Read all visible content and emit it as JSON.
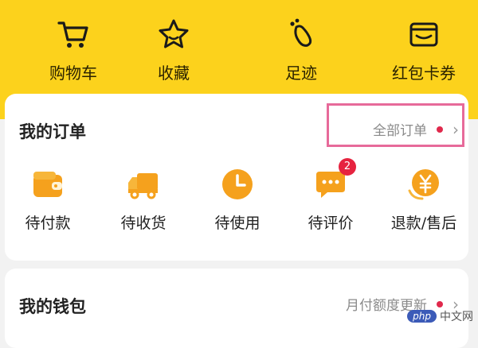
{
  "shortcuts": [
    {
      "label": "购物车",
      "icon": "shopping-cart-icon"
    },
    {
      "label": "收藏",
      "icon": "star-icon"
    },
    {
      "label": "足迹",
      "icon": "footprint-icon"
    },
    {
      "label": "红包卡券",
      "icon": "wallet-icon"
    }
  ],
  "orders": {
    "title": "我的订单",
    "all_orders_label": "全部订单",
    "items": [
      {
        "label": "待付款",
        "icon": "wallet-icon"
      },
      {
        "label": "待收货",
        "icon": "truck-icon"
      },
      {
        "label": "待使用",
        "icon": "clock-icon"
      },
      {
        "label": "待评价",
        "icon": "comment-icon",
        "badge": "2"
      },
      {
        "label": "退款/售后",
        "icon": "refund-icon"
      }
    ]
  },
  "wallet": {
    "title": "我的钱包",
    "notice_label": "月付额度更新"
  },
  "watermark": {
    "logo": "php",
    "text": "中文网"
  },
  "colors": {
    "header_bg": "#fcd21c",
    "accent_orange": "#f5a11d",
    "dot_red": "#e0294c",
    "highlight_pink": "#e76a9a"
  }
}
